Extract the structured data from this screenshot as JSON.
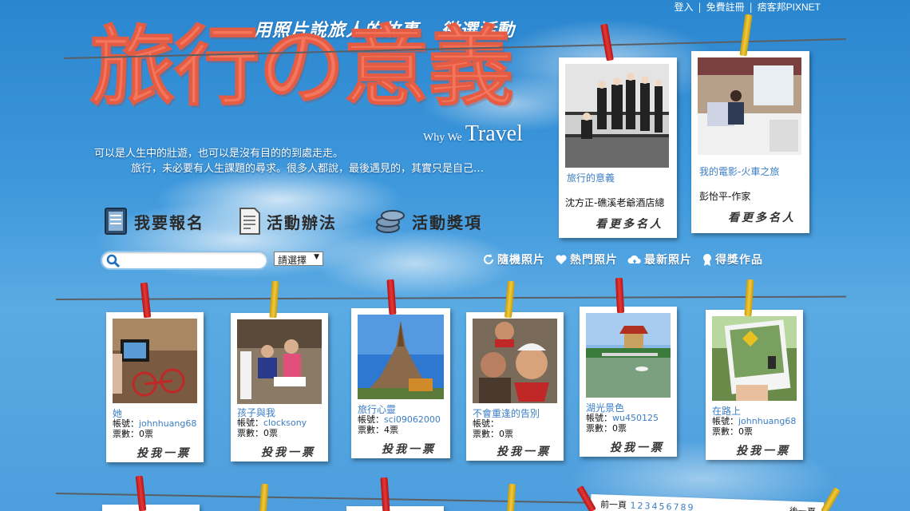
{
  "topnav": {
    "login": "登入",
    "register": "免費註冊",
    "brand": "痞客邦PIXNET"
  },
  "header": {
    "tagline_1": "用照片說旅人的故事",
    "tagline_2": "徵選活動",
    "title": "旅行の意義",
    "subtitle_small": "Why We",
    "subtitle_big": "Travel",
    "intro_1": "可以是人生中的壯遊，也可以是沒有目的的到處走走。",
    "intro_2": "旅行，未必要有人生課題的尋求。很多人都說，最後遇見的，其實只是自己…"
  },
  "nav": {
    "signup": "我要報名",
    "rules": "活動辦法",
    "prizes": "活動獎項"
  },
  "search": {
    "placeholder": "",
    "select_value": "請選擇"
  },
  "filters": {
    "random": "隨機照片",
    "popular": "熱門照片",
    "latest": "最新照片",
    "winners": "得獎作品"
  },
  "featured": [
    {
      "title": "旅行的意義",
      "author": "沈方正-礁溪老爺酒店總",
      "more": "看更多名人"
    },
    {
      "title": "我的電影-火車之旅",
      "author": "彭怡平-作家",
      "more": "看更多名人"
    }
  ],
  "photos": [
    {
      "title": "她",
      "account_label": "帳號：",
      "account": "johnhuang68",
      "votes": "票數：0票",
      "vote_btn": "投我一票"
    },
    {
      "title": "孩子與我",
      "account_label": "帳號：",
      "account": "clocksony",
      "votes": "票數：0票",
      "vote_btn": "投我一票"
    },
    {
      "title": "旅行心靈",
      "account_label": "帳號：",
      "account": "sci09062000",
      "votes": "票數：4票",
      "vote_btn": "投我一票"
    },
    {
      "title": "不會重逢的告別",
      "account_label": "帳號：",
      "account": "",
      "votes": "票數：0票",
      "vote_btn": "投我一票"
    },
    {
      "title": "湖光景色",
      "account_label": "帳號：",
      "account": "wu450125",
      "votes": "票數：0票",
      "vote_btn": "投我一票"
    },
    {
      "title": "在路上",
      "account_label": "帳號：",
      "account": "johnhuang68",
      "votes": "票數：0票",
      "vote_btn": "投我一票"
    }
  ],
  "pager": {
    "prev": "前一頁",
    "pages": [
      "1",
      "2",
      "3",
      "4",
      "5",
      "6",
      "7",
      "8",
      "9"
    ],
    "next": "後一頁"
  },
  "colors": {
    "sky": "#3d97db",
    "title": "#f4765c",
    "link": "#3b7ec4",
    "clip_red": "#e33838",
    "clip_yellow": "#f1cb3a"
  }
}
